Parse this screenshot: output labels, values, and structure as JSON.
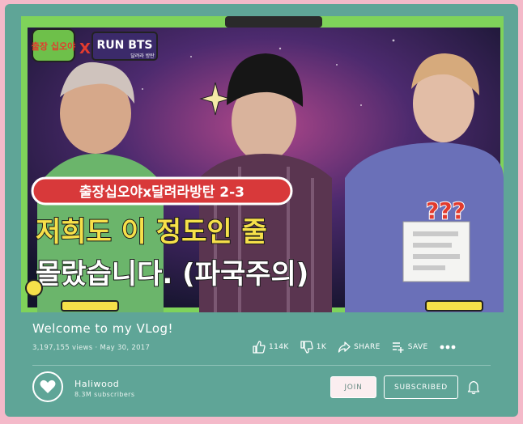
{
  "video": {
    "badge_left": "출장 십오야",
    "badge_x": "X",
    "badge_runbts": "RUN BTS",
    "badge_runbts_sub": "달려라 방탄",
    "episode_label": "출장십오야x달려라방탄 2-3",
    "caption_line1": "저희도 이 정도인 줄",
    "caption_line2": "몰랐습니다. (파국주의)",
    "question_marks": "???"
  },
  "title": "Welcome to my VLog!",
  "meta": "3,197,155 views · May 30, 2017",
  "actions": {
    "likes": "114K",
    "dislikes": "1K",
    "share": "SHARE",
    "save": "SAVE"
  },
  "channel": {
    "name": "Haliwood",
    "subscribers": "8.3M subscribers"
  },
  "buttons": {
    "join": "JOIN",
    "subscribed": "SUBSCRIBED"
  },
  "colors": {
    "page_bg": "#f4b9c9",
    "card_bg": "#5fa597",
    "thumbnail_border": "#7fd35a",
    "caption_yellow": "#f6e04a",
    "episode_red": "#d8393a"
  }
}
